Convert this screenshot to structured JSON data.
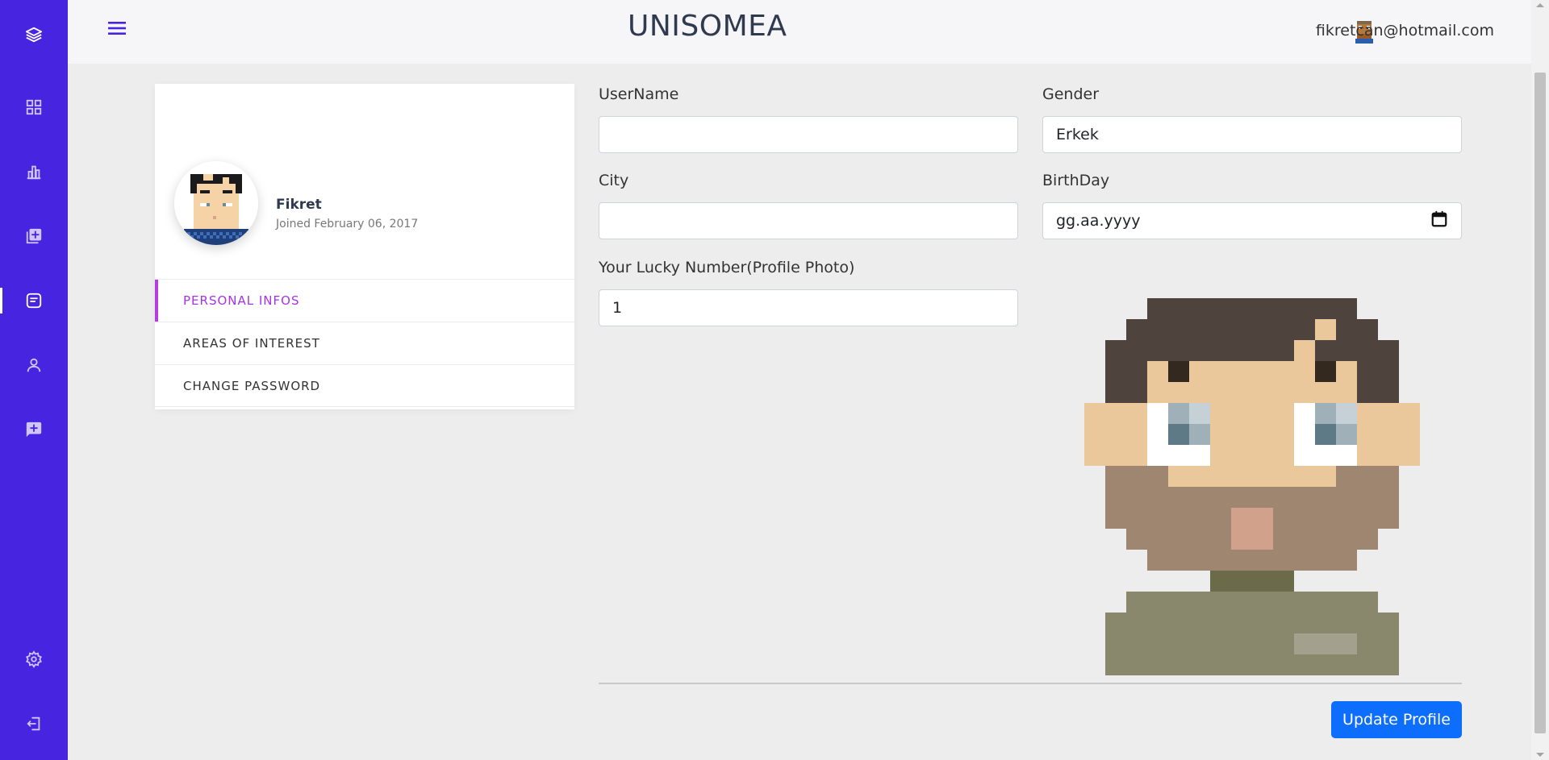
{
  "app": {
    "brand": "UNISOMEA"
  },
  "header": {
    "user_email": "fikretcan@hotmail.com"
  },
  "sidebar": {
    "icons": [
      "layers-icon",
      "dashboard-grid-icon",
      "bar-chart-icon",
      "add-library-icon",
      "notes-icon",
      "user-icon",
      "add-message-icon",
      "settings-gear-icon",
      "logout-icon"
    ],
    "active": "notes-icon"
  },
  "profile": {
    "name": "Fikret",
    "joined": "Joined February 06, 2017"
  },
  "menu": {
    "items": [
      {
        "label": "PERSONAL INFOS"
      },
      {
        "label": "AREAS OF INTEREST"
      },
      {
        "label": "CHANGE PASSWORD"
      }
    ],
    "active_index": 0
  },
  "form": {
    "username": {
      "label": "UserName",
      "value": ""
    },
    "gender": {
      "label": "Gender",
      "value": "Erkek"
    },
    "city": {
      "label": "City",
      "value": ""
    },
    "birthday": {
      "label": "BirthDay",
      "placeholder": "gg.aa.yyyy"
    },
    "lucky": {
      "label": "Your Lucky Number(Profile Photo)",
      "value": "1"
    }
  },
  "actions": {
    "update_label": "Update Profile"
  },
  "colors": {
    "sidebar": "#4624e0",
    "accent": "#b43ee0",
    "button": "#0d6efd"
  }
}
